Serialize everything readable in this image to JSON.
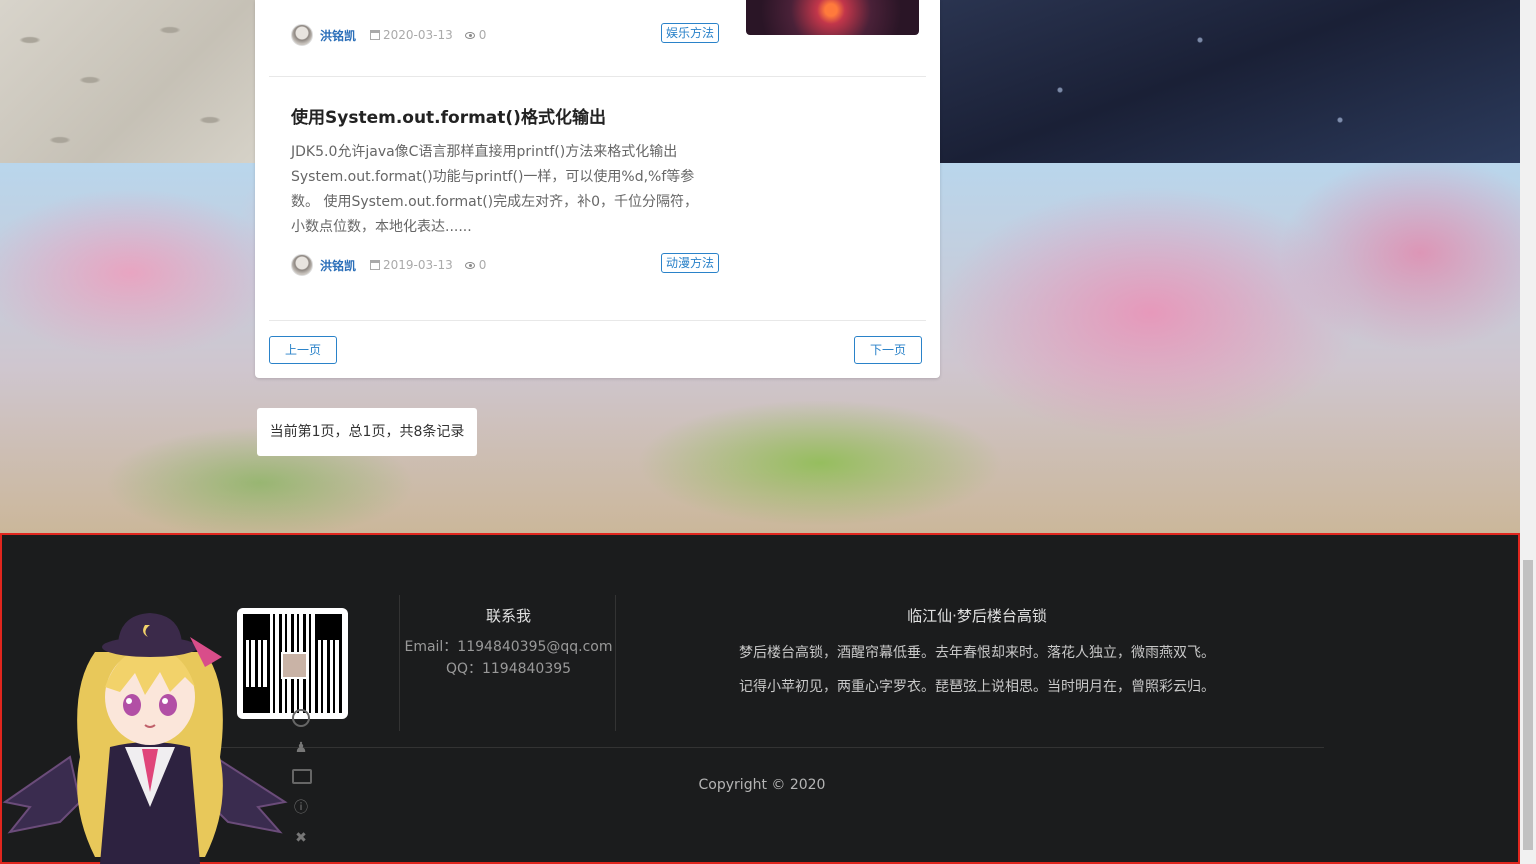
{
  "prev_article": {
    "author": "洪铭凯",
    "date": "2020-03-13",
    "views": "0",
    "tag": "娱乐方法"
  },
  "article": {
    "title": "使用System.out.format()格式化输出",
    "summary": "JDK5.0允许java像C语言那样直接用printf()方法来格式化输出System.out.format()功能与printf()一样，可以使用%d,%f等参数。 使用System.out.format()完成左对齐，补0，千位分隔符，小数点位数，本地化表达......",
    "author": "洪铭凯",
    "date": "2019-03-13",
    "views": "0",
    "tag": "动漫方法"
  },
  "pager": {
    "prev_label": "上一页",
    "next_label": "下一页",
    "info": "当前第1页，总1页，共8条记录"
  },
  "footer": {
    "contact_title": "联系我",
    "email": "Email：1194840395@qq.com",
    "qq": "QQ：1194840395",
    "poem_title": "临江仙·梦后楼台高锁",
    "poem_line1": "梦后楼台高锁，酒醒帘幕低垂。去年春恨却来时。落花人独立，微雨燕双飞。",
    "poem_line2": "记得小苹初见，两重心字罗衣。琵琶弦上说相思。当时明月在，曾照彩云归。",
    "copyright": "Copyright © 2020",
    "side_icons": [
      "user-icon",
      "person-icon",
      "camera-icon",
      "info-icon",
      "close-icon"
    ]
  },
  "colors": {
    "accent": "#2a82c9",
    "footer_bg": "#1b1c1d",
    "highlight_border": "#e0261e"
  }
}
